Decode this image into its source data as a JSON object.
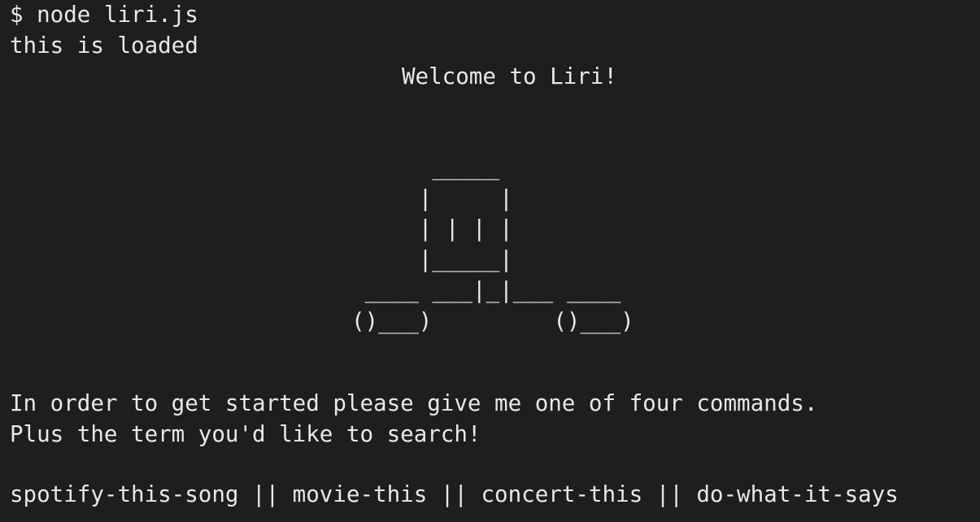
{
  "terminal": {
    "command": "$ node liri.js",
    "loaded_message": "this is loaded",
    "welcome": "Welcome to Liri!",
    "ascii_art": "      _____\n     |     |\n     | | | |\n     |_____|\n ____ ___|_|___ ____\n()___)         ()___)",
    "instructions": [
      "In order to get started please give me one of four commands.",
      "Plus the term you'd like to search!"
    ],
    "commands_line": "spotify-this-song || movie-this || concert-this || do-what-it-says"
  },
  "colors": {
    "background": "#1e1e1e",
    "text": "#e8e8e8"
  }
}
